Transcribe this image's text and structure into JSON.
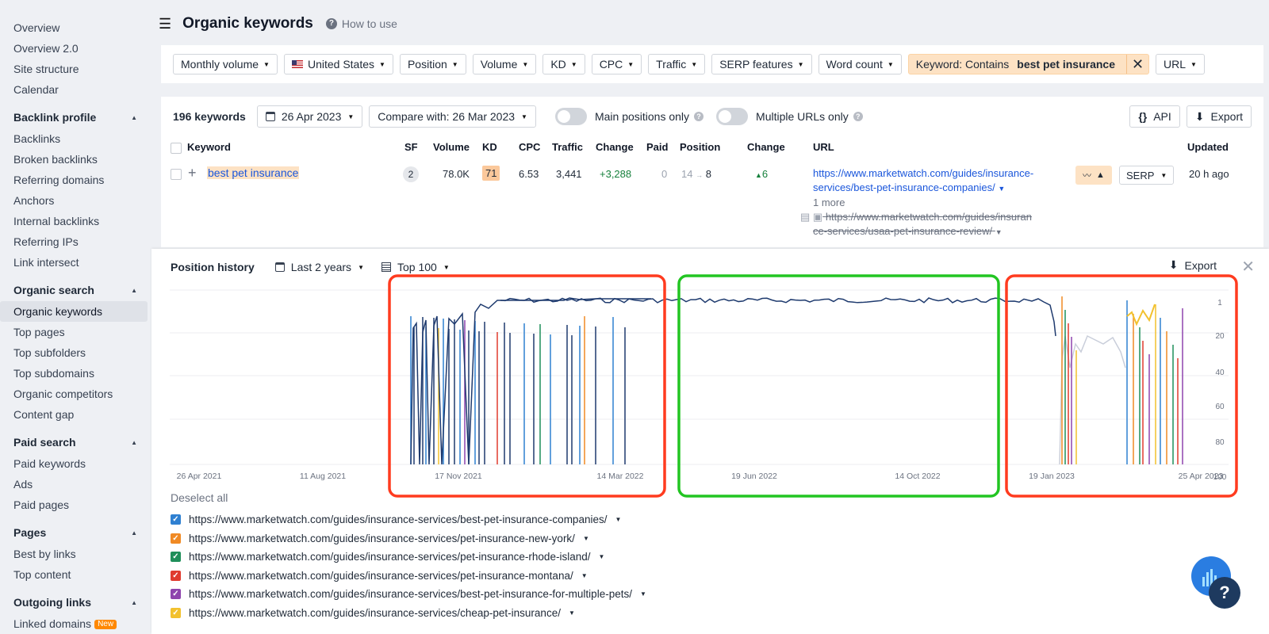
{
  "sidebar": {
    "top_items": [
      "Overview",
      "Overview 2.0",
      "Site structure",
      "Calendar"
    ],
    "sections": [
      {
        "title": "Backlink profile",
        "items": [
          "Backlinks",
          "Broken backlinks",
          "Referring domains",
          "Anchors",
          "Internal backlinks",
          "Referring IPs",
          "Link intersect"
        ]
      },
      {
        "title": "Organic search",
        "items": [
          "Organic keywords",
          "Top pages",
          "Top subfolders",
          "Top subdomains",
          "Organic competitors",
          "Content gap"
        ]
      },
      {
        "title": "Paid search",
        "items": [
          "Paid keywords",
          "Ads",
          "Paid pages"
        ]
      },
      {
        "title": "Pages",
        "items": [
          "Best by links",
          "Top content"
        ]
      },
      {
        "title": "Outgoing links",
        "items": [
          "Linked domains"
        ]
      }
    ],
    "active_item": "Organic keywords",
    "new_badge": "New"
  },
  "header": {
    "title": "Organic keywords",
    "how_to_use": "How to use"
  },
  "filters": {
    "monthly_volume": "Monthly volume",
    "country": "United States",
    "position": "Position",
    "volume": "Volume",
    "kd": "KD",
    "cpc": "CPC",
    "traffic": "Traffic",
    "serp_features": "SERP features",
    "word_count": "Word count",
    "keyword_prefix": "Keyword: Contains",
    "keyword_value": "best pet insurance",
    "url": "URL"
  },
  "table_toolbar": {
    "count": "196 keywords",
    "date": "26 Apr 2023",
    "compare": "Compare with: 26 Mar 2023",
    "main_positions": "Main positions only",
    "multiple_urls": "Multiple URLs only",
    "api": "API",
    "export": "Export"
  },
  "columns": {
    "keyword": "Keyword",
    "sf": "SF",
    "volume": "Volume",
    "kd": "KD",
    "cpc": "CPC",
    "traffic": "Traffic",
    "change": "Change",
    "paid": "Paid",
    "position": "Position",
    "change2": "Change",
    "url": "URL",
    "updated": "Updated"
  },
  "row": {
    "keyword": "best pet insurance",
    "sf": "2",
    "volume": "78.0K",
    "kd": "71",
    "cpc": "6.53",
    "traffic": "3,441",
    "change": "+3,288",
    "paid": "0",
    "position_from": "14",
    "position_to": "8",
    "position_change": "6",
    "url_line1": "https://www.marketwatch.com/guides/insurance-",
    "url_line2": "services/best-pet-insurance-companies/",
    "more": "1 more",
    "old_url_line1": "https://www.marketwatch.com/guides/insuran",
    "old_url_line2": "ce-services/usaa-pet-insurance-review/",
    "serp": "SERP",
    "updated": "20 h ago"
  },
  "position_history": {
    "title": "Position history",
    "range": "Last 2 years",
    "top": "Top 100",
    "export": "Export",
    "x_ticks": [
      "26 Apr 2021",
      "11 Aug 2021",
      "17 Nov 2021",
      "14 Mar 2022",
      "19 Jun 2022",
      "14 Oct 2022",
      "19 Jan 2023",
      "25 Apr 2023"
    ],
    "y_ticks": [
      "1",
      "20",
      "40",
      "60",
      "80",
      "100"
    ],
    "deselect_all": "Deselect all",
    "urls": [
      {
        "url": "https://www.marketwatch.com/guides/insurance-services/best-pet-insurance-companies/",
        "color": "#2f80d1"
      },
      {
        "url": "https://www.marketwatch.com/guides/insurance-services/pet-insurance-new-york/",
        "color": "#f08a24"
      },
      {
        "url": "https://www.marketwatch.com/guides/insurance-services/pet-insurance-rhode-island/",
        "color": "#1f8f5a"
      },
      {
        "url": "https://www.marketwatch.com/guides/insurance-services/pet-insurance-montana/",
        "color": "#e03b2f"
      },
      {
        "url": "https://www.marketwatch.com/guides/insurance-services/best-pet-insurance-for-multiple-pets/",
        "color": "#8e44ad"
      },
      {
        "url": "https://www.marketwatch.com/guides/insurance-services/cheap-pet-insurance/",
        "color": "#f2c12e"
      }
    ]
  },
  "colors": {
    "highlight": "#fde2c4",
    "link": "#1a56db",
    "main_line": "#1e3a6e",
    "box_red": "#ff3b1f",
    "box_green": "#22c522"
  }
}
